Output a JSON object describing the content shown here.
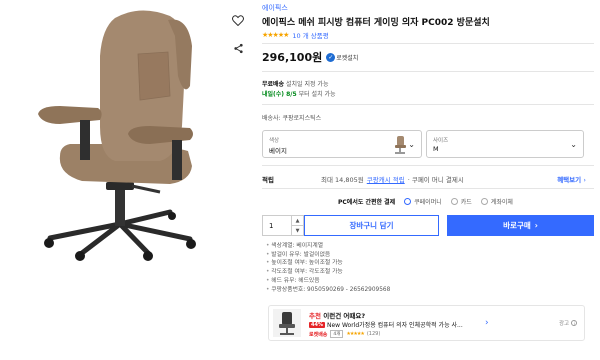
{
  "product": {
    "brand": "에이픽스",
    "title": "에이픽스 메쉬 피시방 컴퓨터 게이밍 의자 PC002 방문설치",
    "rating_stars": "★★★★★",
    "review_count": "10 개 상품평",
    "price": "296,100원",
    "rocket_label": "로켓설치"
  },
  "shipping": {
    "free_label": "무료배송",
    "free_text": "설치일 지정 가능",
    "arrival_date": "내일(수) 8/5",
    "arrival_text": "부터 설치 가능",
    "delivery_text": "배송사: 쿠팡로지스틱스"
  },
  "options": {
    "color": {
      "label": "색상",
      "value": "베이지"
    },
    "size": {
      "label": "사이즈",
      "value": "M"
    }
  },
  "cash": {
    "label": "적립",
    "max_text": "최대 14,805원",
    "link_text": "쿠팡캐시 적립",
    "suffix_text": "· 쿠페이 머니 결제시",
    "benefit_link": "혜택보기",
    "benefit_arrow": "›"
  },
  "payment": {
    "main": "PC에서도 간편한 결제",
    "methods": [
      "쿠페이머니",
      "카드",
      "계좌이체"
    ]
  },
  "purchase": {
    "quantity": "1",
    "cart_label": "장바구니 담기",
    "buy_label": "바로구매",
    "buy_arrow": "›"
  },
  "specs": [
    "색상계열: 베이지계열",
    "발걸이 유무: 발걸이없음",
    "높이조절 여부: 높이조절 가능",
    "각도조절 여부: 각도조절 가능",
    "헤드 유무: 헤드있음",
    "쿠팡상품번호: 9050590269 - 26562909568"
  ],
  "recommend": {
    "prefix": "추천",
    "head": "이런건 어때요?",
    "discount": "44%",
    "title": "New World가정용 컴퓨터 의자 인체공학적 가능 사...",
    "rocket": "로켓배송",
    "pill": "4개",
    "stars": "★★★★★",
    "count": "(129)",
    "chevron": "›",
    "ad_label": "광고",
    "ad_icon": "i"
  },
  "icons": {
    "heart": "heart-icon",
    "share": "share-icon"
  },
  "colors": {
    "accent": "#346aff",
    "green": "#00891a",
    "star": "#f6a400",
    "chair": "#a4896f",
    "red": "#e52528"
  }
}
